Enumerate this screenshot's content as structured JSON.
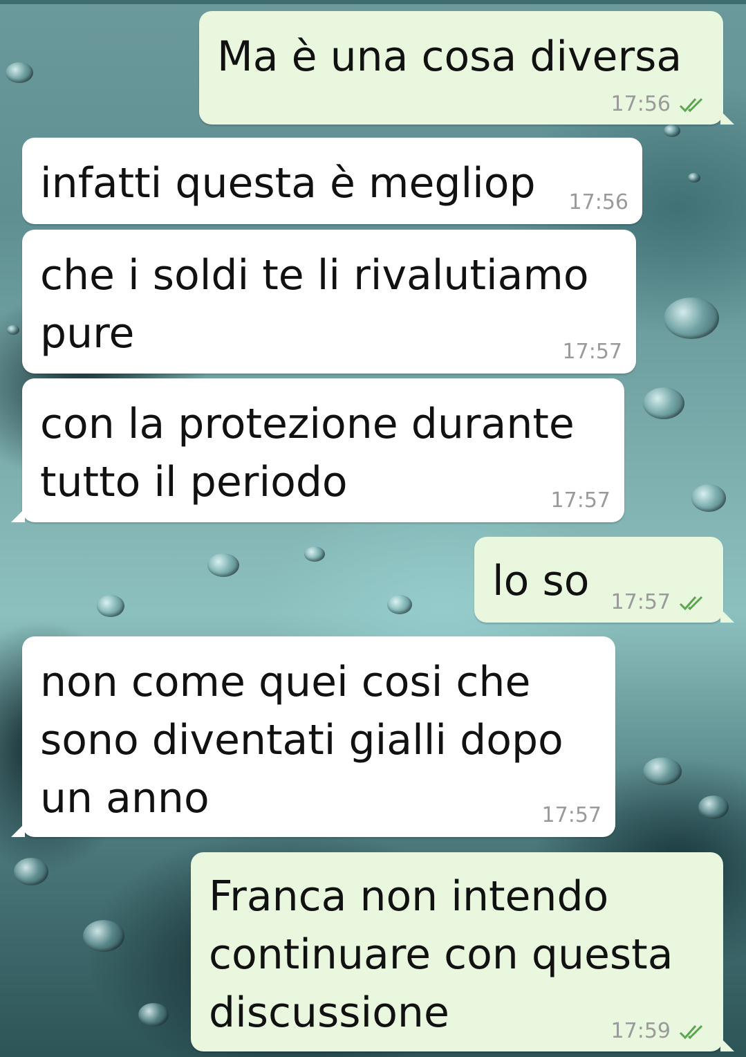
{
  "messages": [
    {
      "direction": "outgoing",
      "text": "Ma è una cosa diversa",
      "time": "17:56",
      "status_icon": "read-double-check-icon"
    },
    {
      "direction": "incoming",
      "text": "infatti questa è megliop",
      "time": "17:56"
    },
    {
      "direction": "incoming",
      "text": "che i soldi te li rivalutiamo\npure",
      "time": "17:57"
    },
    {
      "direction": "incoming",
      "text": "con la protezione durante\ntutto il periodo",
      "time": "17:57"
    },
    {
      "direction": "outgoing",
      "text": "lo so",
      "time": "17:57",
      "status_icon": "read-double-check-icon"
    },
    {
      "direction": "incoming",
      "text": "non come quei cosi che\nsono diventati gialli dopo\nun anno",
      "time": "17:57"
    },
    {
      "direction": "outgoing",
      "text": "Franca non intendo\ncontinuare con questa\ndiscussione",
      "time": "17:59",
      "status_icon": "read-double-check-icon"
    }
  ],
  "colors": {
    "incoming_bubble": "#ffffff",
    "outgoing_bubble": "#e8f7dd",
    "message_text": "#111111",
    "timestamp": "#9a9a9a",
    "read_ticks": "#5aa64f"
  }
}
